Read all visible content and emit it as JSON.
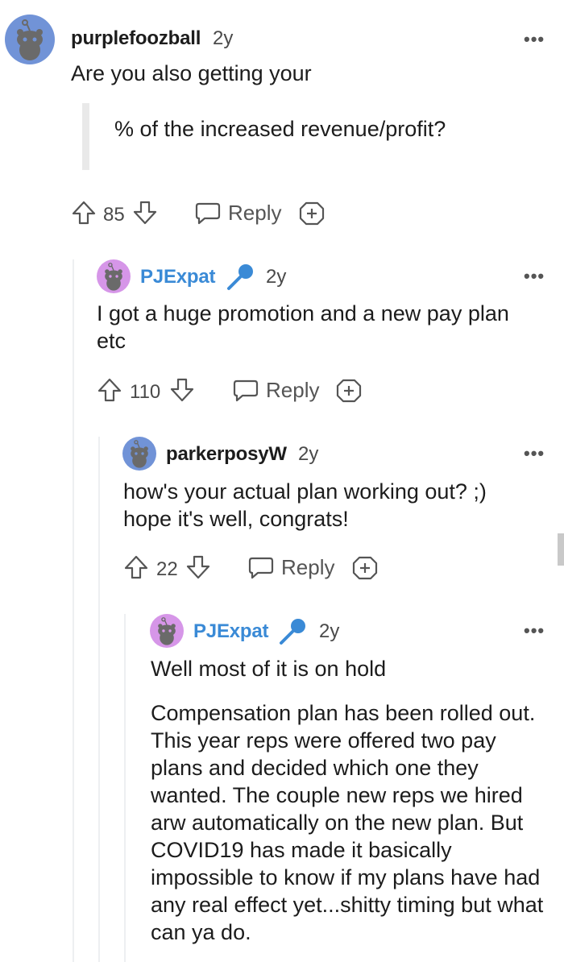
{
  "colors": {
    "op_avatar_bg": "#7193d7",
    "pj_avatar_bg": "#d696e8",
    "op_username": "#1c1c1c",
    "pj_username": "#3a8ad6",
    "mic_icon": "#3a8ad6",
    "icon_stroke": "#555555"
  },
  "comments": [
    {
      "username": "purplefoozball",
      "age": "2y",
      "more": "•••",
      "text": "Are you also getting your",
      "quote": "% of the increased revenue/profit?",
      "votes": "85",
      "reply_label": "Reply",
      "avatar_icon": "snoo-avatar-icon"
    },
    {
      "username": "PJExpat",
      "age": "2y",
      "more": "•••",
      "flair_icon": "microphone-icon",
      "text": "I got a huge promotion and a new pay plan etc",
      "votes": "110",
      "reply_label": "Reply",
      "avatar_icon": "snoo-avatar-icon"
    },
    {
      "username": "parkerposyW",
      "age": "2y",
      "more": "•••",
      "text": "how's your actual plan working out? ;) hope it's well, congrats!",
      "votes": "22",
      "reply_label": "Reply",
      "avatar_icon": "snoo-avatar-icon"
    },
    {
      "username": "PJExpat",
      "age": "2y",
      "more": "•••",
      "flair_icon": "microphone-icon",
      "text": "Well most of it is on hold",
      "text2": "Compensation plan has been rolled out. This year reps were offered two pay plans and decided which one they wanted. The couple new reps we hired arw automatically on the new plan. But COVID19 has made it basically impossible to know if my plans have had any real effect yet...shitty timing but what can ya do.",
      "avatar_icon": "snoo-avatar-icon"
    }
  ]
}
